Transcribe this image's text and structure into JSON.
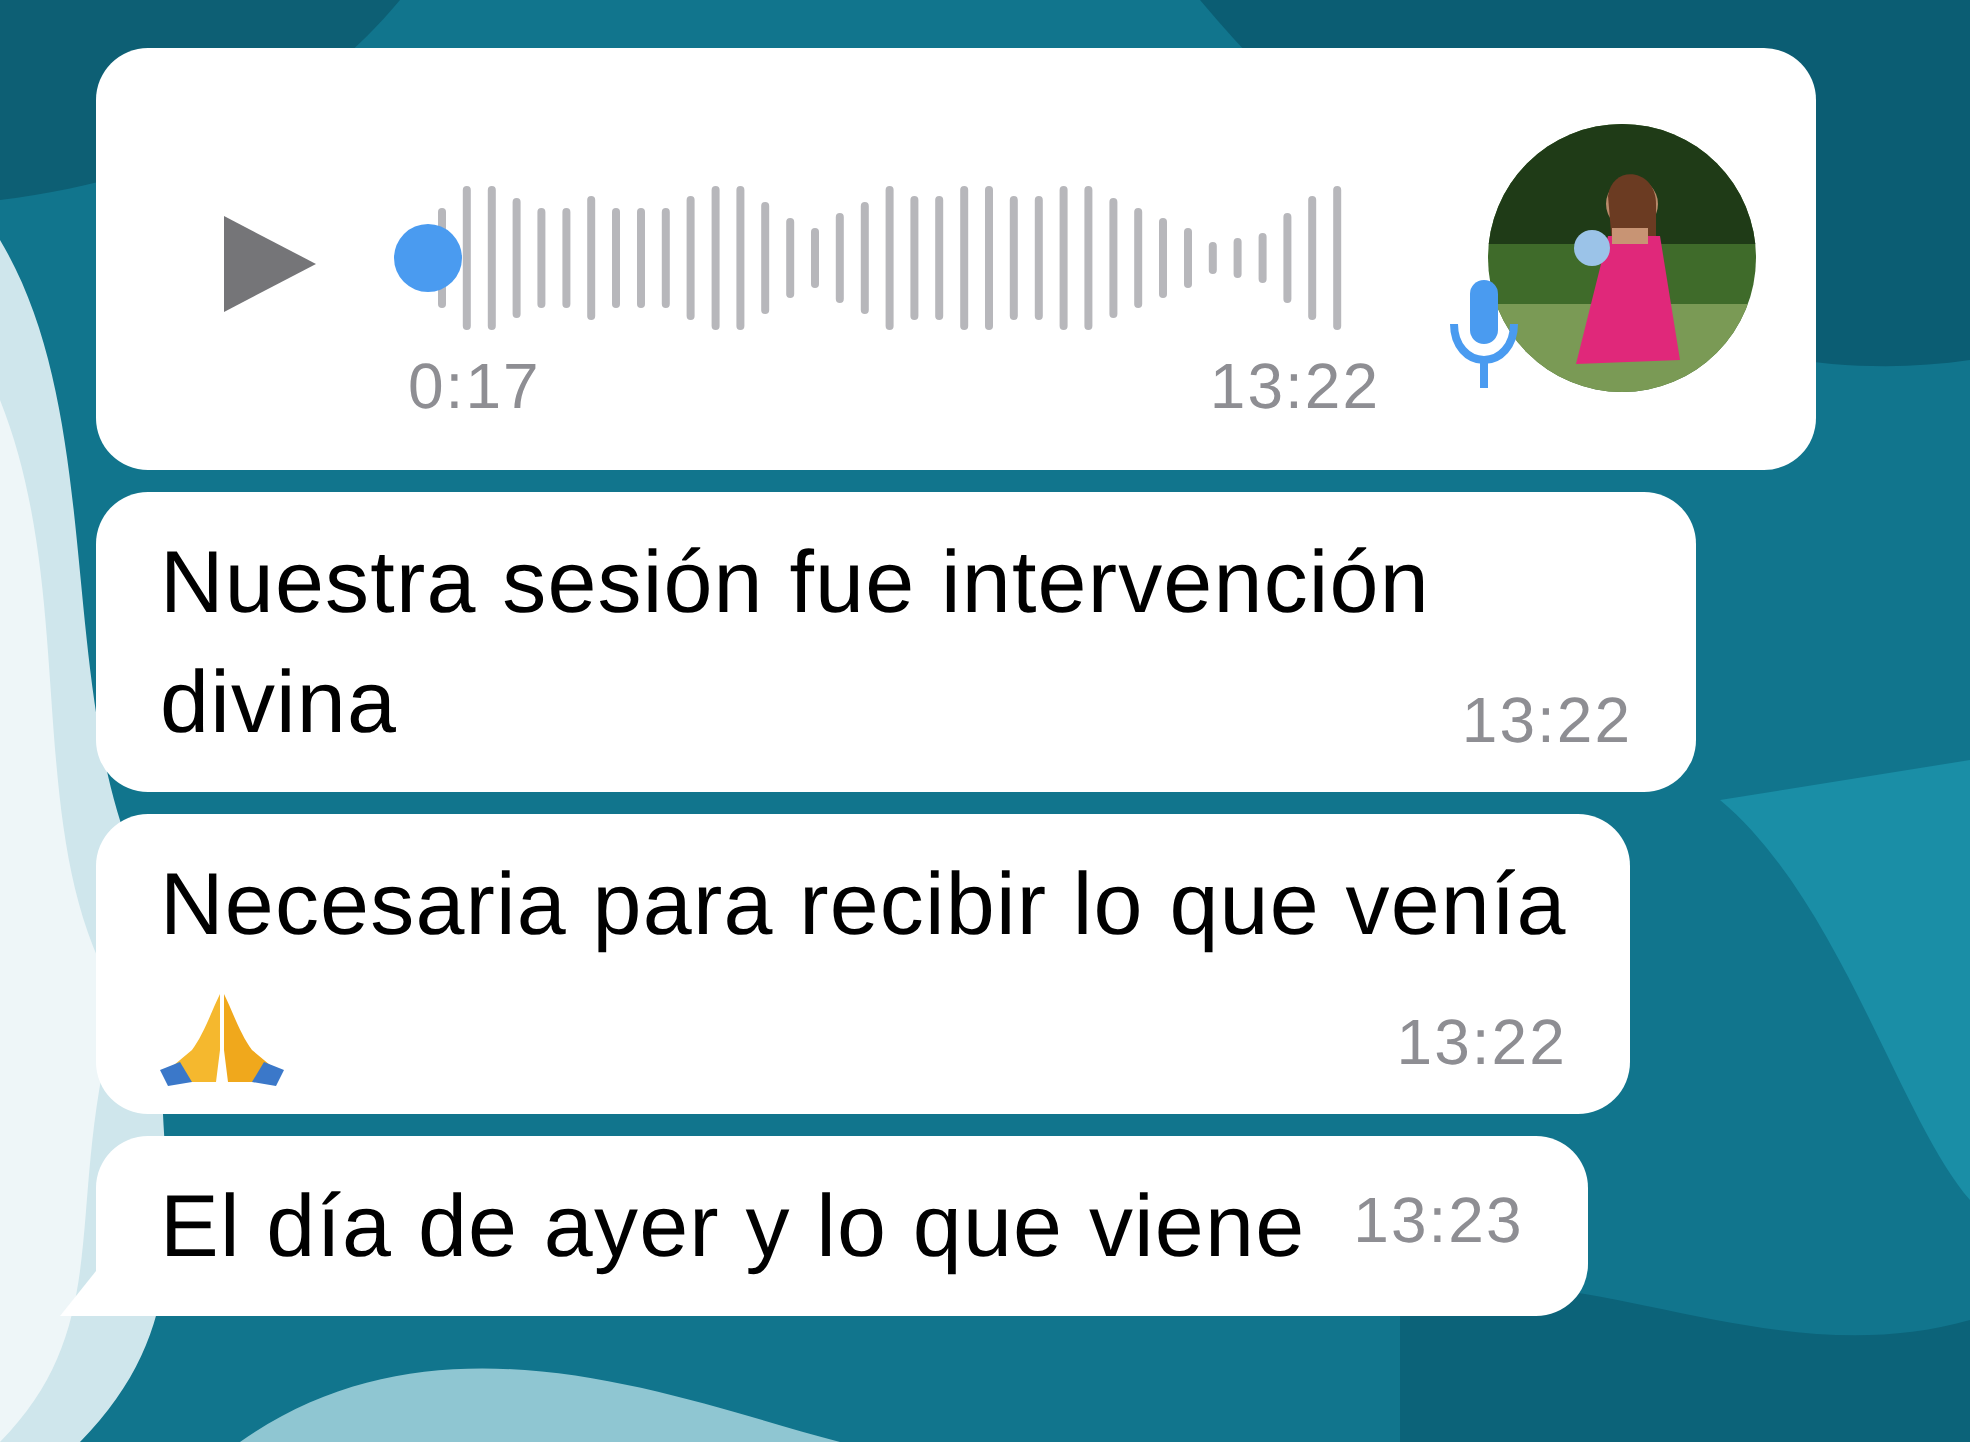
{
  "messages": [
    {
      "kind": "voice",
      "duration": "0:17",
      "time": "13:22",
      "level": 0,
      "tail": false
    },
    {
      "kind": "text",
      "text": "Nuestra sesión fue intervención divina",
      "time": "13:22",
      "tail": false
    },
    {
      "kind": "text-emoji",
      "text": "Necesaria para recibir lo que venía",
      "time": "13:22",
      "tail": false
    },
    {
      "kind": "text",
      "text": "El día de ayer y lo que viene",
      "time": "13:23",
      "tail": true
    }
  ]
}
